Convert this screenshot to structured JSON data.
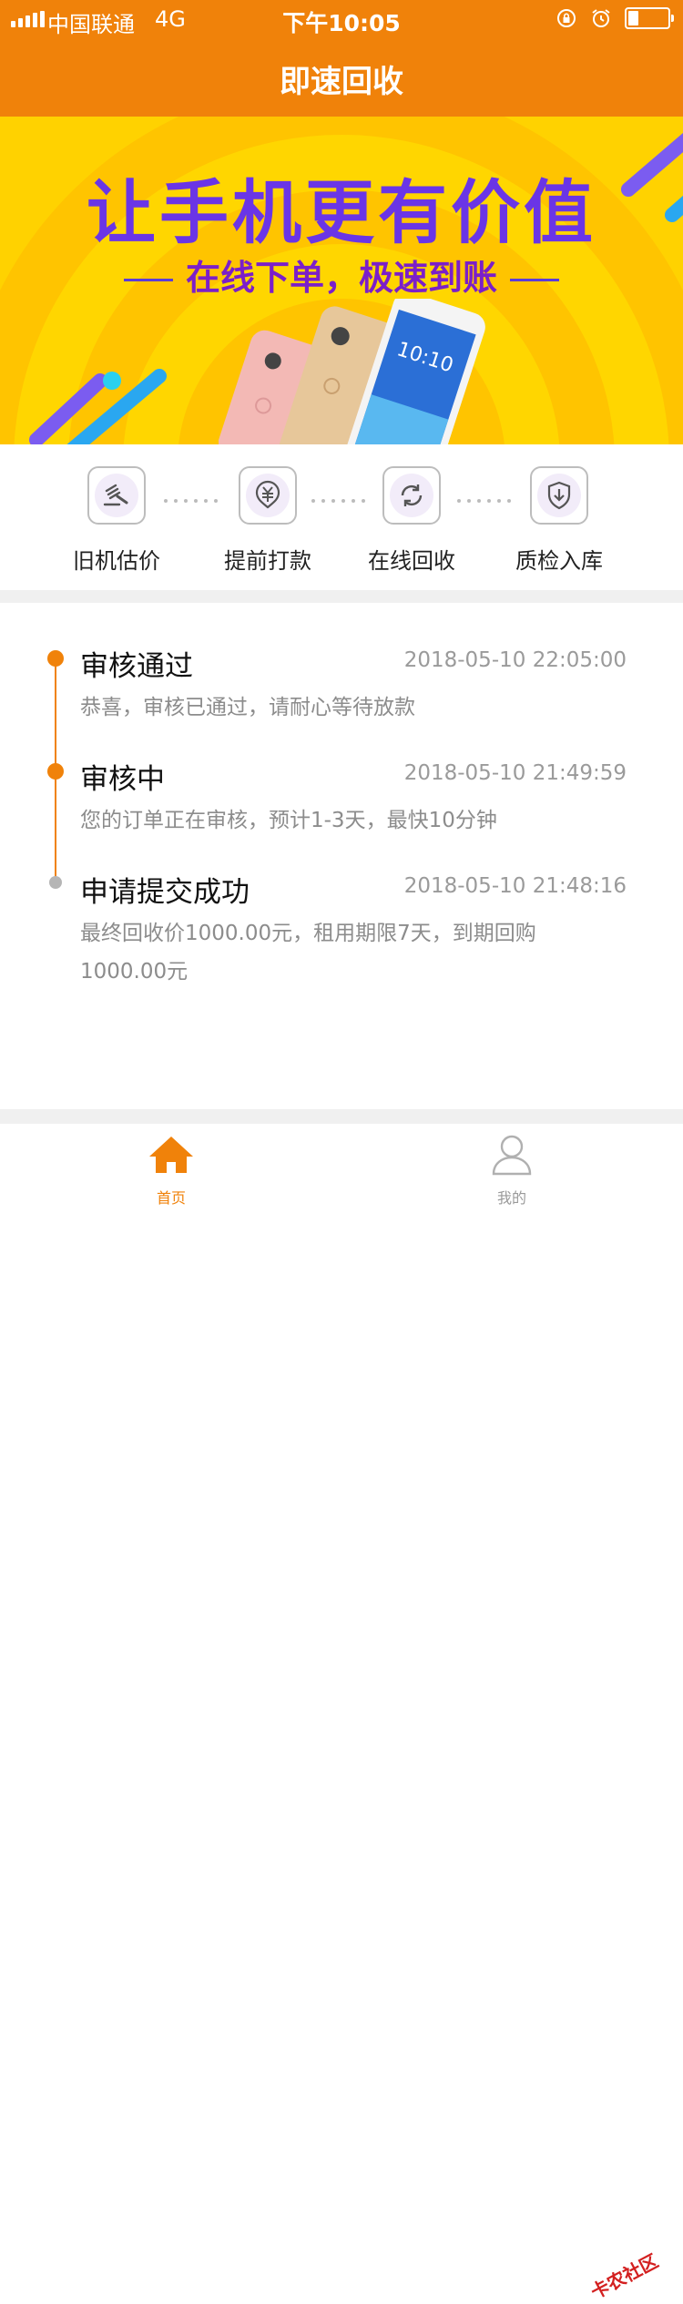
{
  "status_bar": {
    "carrier": "中国联通",
    "network": "4G",
    "time": "下午10:05",
    "battery_level": 0.25
  },
  "nav": {
    "title": "即速回收"
  },
  "banner": {
    "headline": "让手机更有价值",
    "subline": "在线下单，极速到账",
    "phone_screen_time": "10:10"
  },
  "steps": [
    {
      "label": "旧机估价",
      "icon": "gavel-icon"
    },
    {
      "label": "提前打款",
      "icon": "yuan-icon"
    },
    {
      "label": "在线回收",
      "icon": "recycle-icon"
    },
    {
      "label": "质检入库",
      "icon": "shield-download-icon"
    }
  ],
  "timeline": [
    {
      "title": "审核通过",
      "time": "2018-05-10 22:05:00",
      "desc": "恭喜，审核已通过，请耐心等待放款",
      "active": true
    },
    {
      "title": "审核中",
      "time": "2018-05-10 21:49:59",
      "desc": "您的订单正在审核，预计1-3天，最快10分钟",
      "active": true
    },
    {
      "title": "申请提交成功",
      "time": "2018-05-10 21:48:16",
      "desc": "最终回收价1000.00元，租用期限7天，到期回购1000.00元",
      "active": false
    }
  ],
  "tabbar": {
    "home_label": "首页",
    "mine_label": "我的"
  },
  "watermark": "卡农社区",
  "colors": {
    "accent": "#f0820a",
    "banner_bg": "#ffd200",
    "headline": "#6a35e6",
    "inactive": "#b5b5b5"
  }
}
